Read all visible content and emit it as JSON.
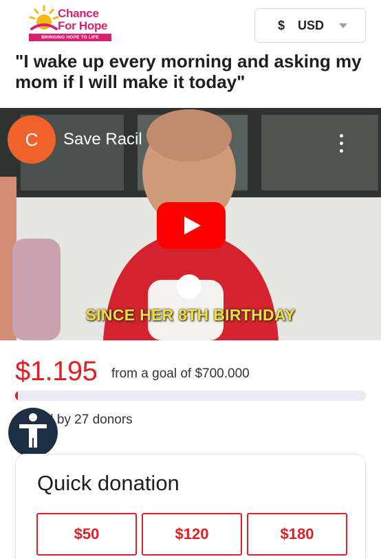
{
  "header": {
    "logo": {
      "line1": "Chance",
      "line2": "For Hope",
      "tagline": "BRINGING HOPE TO LIFE"
    },
    "currency": {
      "symbol": "$",
      "code": "USD"
    }
  },
  "campaign": {
    "title": "\"I wake up every morning and asking my mom if I will make it today\""
  },
  "video": {
    "channel_initial": "C",
    "channel_name": "Save Racil",
    "caption": "SINCE HER 8TH BIRTHDAY"
  },
  "funding": {
    "raised": "$1.195",
    "goal_text": "from a goal of $700.000",
    "progress_fraction": 0.0017,
    "donors_text": "nated by 27 donors"
  },
  "quick_donation": {
    "title": "Quick donation",
    "amounts": [
      "$50",
      "$120",
      "$180"
    ]
  },
  "colors": {
    "brand_pink": "#d9206f",
    "accent_red": "#e01f26",
    "youtube_red": "#ff0000",
    "avatar_orange": "#f0622a",
    "accessibility_navy": "#1c2f44"
  }
}
